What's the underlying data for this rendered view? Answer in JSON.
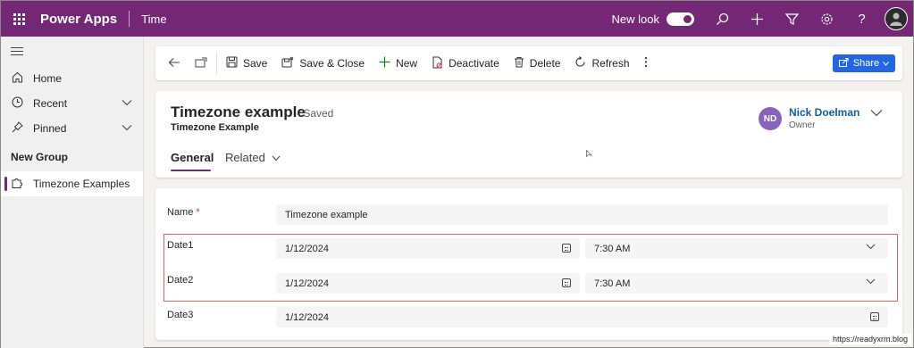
{
  "topbar": {
    "app_name": "Power Apps",
    "area": "Time",
    "new_look_label": "New look",
    "new_look_on": true,
    "icons": [
      "waffle-icon",
      "search-icon",
      "plus-icon",
      "filter-icon",
      "gear-icon",
      "help-icon",
      "avatar"
    ]
  },
  "sidebar": {
    "items": [
      {
        "label": "Home",
        "icon": "home-icon"
      },
      {
        "label": "Recent",
        "icon": "clock-icon",
        "has_chevron": true
      },
      {
        "label": "Pinned",
        "icon": "pin-icon",
        "has_chevron": true
      }
    ],
    "group_title": "New Group",
    "group_items": [
      {
        "label": "Timezone Examples",
        "icon": "puzzle-icon",
        "active": true
      }
    ]
  },
  "commandbar": {
    "save": "Save",
    "save_close": "Save & Close",
    "new": "New",
    "deactivate": "Deactivate",
    "delete": "Delete",
    "refresh": "Refresh",
    "share": "Share"
  },
  "header": {
    "title": "Timezone example",
    "saved_status": "- Saved",
    "entity": "Timezone Example",
    "owner_initials": "ND",
    "owner_name": "Nick Doelman",
    "owner_role": "Owner",
    "tabs": [
      "General",
      "Related"
    ]
  },
  "form": {
    "name_label": "Name",
    "name_required": "*",
    "name_value": "Timezone example",
    "fields": [
      {
        "label": "Date1",
        "date": "1/12/2024",
        "time": "7:30 AM"
      },
      {
        "label": "Date2",
        "date": "1/12/2024",
        "time": "7:30 AM"
      },
      {
        "label": "Date3",
        "date": "1/12/2024"
      }
    ]
  },
  "footer_url": "https://readyxrm.blog",
  "colors": {
    "topbar": "#742774",
    "accent": "#742774",
    "share": "#2266e3",
    "owner_avatar": "#8764b8",
    "highlight": "#e06666"
  }
}
